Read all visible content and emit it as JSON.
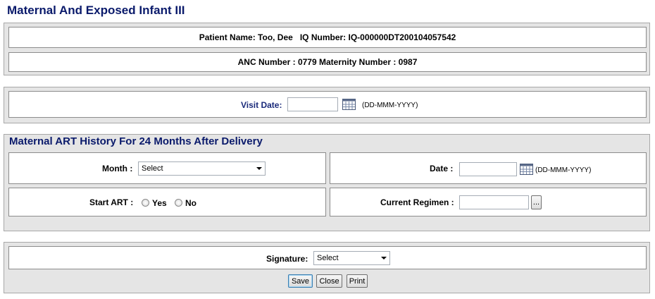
{
  "page": {
    "title": "Maternal And Exposed Infant III"
  },
  "patient": {
    "name_line": "Patient Name: Too, Dee   IQ Number: IQ-000000DT200104057542",
    "anc_line": "ANC Number : 0779 Maternity Number : 0987"
  },
  "visit": {
    "label": "Visit Date:",
    "value": "",
    "format_hint": "(DD-MMM-YYYY)",
    "calendar_icon": "calendar-icon"
  },
  "art_history": {
    "heading": "Maternal ART History For 24 Months After Delivery",
    "month_label": "Month :",
    "month_selected": "Select",
    "date_label": "Date :",
    "date_value": "",
    "date_hint": "(DD-MMM-YYYY)",
    "start_art_label": "Start ART :",
    "yes_label": "Yes",
    "no_label": "No",
    "regimen_label": "Current Regimen :",
    "regimen_value": "",
    "browse_label": "..."
  },
  "signature": {
    "label": "Signature:",
    "selected": "Select"
  },
  "buttons": {
    "save": "Save",
    "close": "Close",
    "print": "Print"
  },
  "colors": {
    "heading": "#0a1a6b",
    "panel_bg": "#e5e5e5",
    "box_border": "#8c8c8c"
  }
}
